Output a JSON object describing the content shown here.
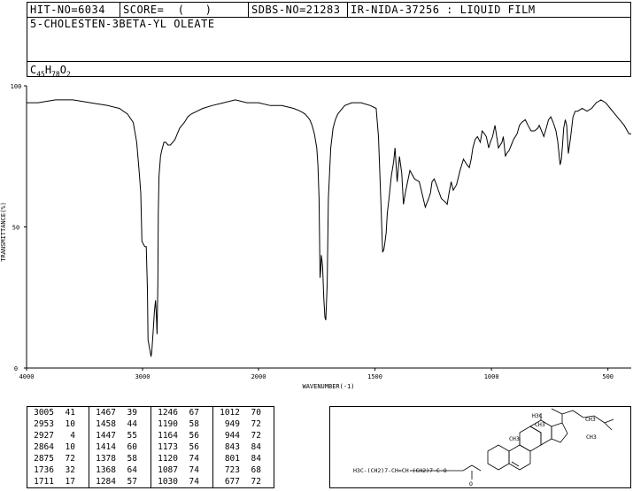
{
  "header": {
    "hit_no": "HIT-NO=6034",
    "score": "SCORE=  (   )",
    "sdbs_no": "SDBS-NO=21283",
    "ir_info": "IR-NIDA-37256 : LIQUID FILM",
    "compound_name": "5-CHOLESTEN-3BETA-YL OLEATE",
    "formula_parts": {
      "c": "C",
      "c_sub": "45",
      "h": "H",
      "h_sub": "78",
      "o": "O",
      "o_sub": "2"
    }
  },
  "chart_data": {
    "type": "line",
    "xlabel": "WAVENUMBER(-1)",
    "ylabel": "TRANSMITTANCE(%)",
    "xlim": [
      4000,
      400
    ],
    "ylim": [
      0,
      100
    ],
    "x_ticks": [
      4000,
      3000,
      2000,
      1500,
      1000,
      500
    ],
    "y_ticks": [
      0,
      50,
      100
    ],
    "series": [
      {
        "x": [
          4000,
          3900,
          3750,
          3600,
          3450,
          3300,
          3200,
          3130,
          3080,
          3050,
          3030,
          3015,
          3005,
          2995,
          2980,
          2968,
          2958,
          2953,
          2948,
          2940,
          2935,
          2927,
          2920,
          2910,
          2898,
          2888,
          2880,
          2875,
          2868,
          2864,
          2858,
          2850,
          2845,
          2835,
          2815,
          2800,
          2780,
          2760,
          2740,
          2720,
          2700,
          2680,
          2660,
          2640,
          2610,
          2580,
          2530,
          2480,
          2400,
          2300,
          2200,
          2100,
          2050,
          2000,
          1950,
          1900,
          1850,
          1820,
          1800,
          1790,
          1780,
          1770,
          1760,
          1750,
          1745,
          1740,
          1736,
          1733,
          1730,
          1725,
          1720,
          1715,
          1711,
          1705,
          1700,
          1690,
          1680,
          1670,
          1660,
          1650,
          1630,
          1600,
          1560,
          1520,
          1495,
          1485,
          1475,
          1467,
          1462,
          1458,
          1452,
          1447,
          1440,
          1430,
          1420,
          1414,
          1405,
          1395,
          1385,
          1378,
          1370,
          1360,
          1350,
          1330,
          1310,
          1284,
          1270,
          1262,
          1255,
          1246,
          1236,
          1228,
          1215,
          1200,
          1190,
          1182,
          1173,
          1164,
          1150,
          1135,
          1120,
          1105,
          1095,
          1087,
          1080,
          1070,
          1060,
          1048,
          1040,
          1030,
          1022,
          1012,
          1005,
          995,
          985,
          970,
          955,
          949,
          940,
          935,
          925,
          915,
          905,
          890,
          880,
          870,
          855,
          843,
          830,
          815,
          801,
          795,
          785,
          775,
          765,
          755,
          745,
          735,
          723,
          715,
          705,
          700,
          695,
          690,
          683,
          677,
          670,
          660,
          650,
          640,
          630,
          610,
          590,
          570,
          550,
          530,
          510,
          500,
          490,
          470,
          450,
          430,
          410,
          400
        ],
        "values": [
          94,
          94,
          95,
          95,
          94,
          93,
          92,
          90,
          87,
          80,
          70,
          62,
          45,
          44,
          43,
          43,
          28,
          10,
          9,
          7,
          6,
          4,
          6,
          12,
          20,
          24,
          18,
          12,
          30,
          55,
          68,
          72,
          75,
          77,
          80,
          80,
          79,
          79,
          80,
          81,
          83,
          85,
          86,
          87,
          89,
          90,
          91,
          92,
          93,
          94,
          95,
          94,
          94,
          94,
          93,
          93,
          92,
          91,
          90,
          89,
          88,
          86,
          83,
          78,
          72,
          60,
          32,
          35,
          40,
          36,
          25,
          18,
          17,
          30,
          60,
          78,
          85,
          88,
          90,
          91,
          93,
          94,
          94,
          93,
          92,
          82,
          60,
          41,
          42,
          44,
          48,
          55,
          60,
          68,
          73,
          78,
          66,
          75,
          69,
          58,
          62,
          66,
          70,
          67,
          66,
          57,
          60,
          62,
          66,
          67,
          65,
          63,
          60,
          59,
          58,
          62,
          66,
          63,
          65,
          70,
          74,
          72,
          71,
          74,
          78,
          81,
          82,
          80,
          84,
          83,
          82,
          78,
          80,
          82,
          86,
          78,
          80,
          82,
          75,
          76,
          77,
          79,
          81,
          83,
          86,
          87,
          88,
          86,
          84,
          84,
          85,
          86,
          84,
          82,
          85,
          88,
          89,
          87,
          84,
          80,
          72,
          74,
          79,
          85,
          88,
          86,
          76,
          82,
          89,
          91,
          91,
          92,
          91,
          92,
          94,
          95,
          94,
          93,
          92,
          90,
          88,
          86,
          83,
          83
        ]
      }
    ]
  },
  "peak_table": [
    [
      [
        "3005",
        "41"
      ],
      [
        "2953",
        "10"
      ],
      [
        "2927",
        "4"
      ],
      [
        "2864",
        "10"
      ],
      [
        "2875",
        "72"
      ],
      [
        "1736",
        "32"
      ],
      [
        "1711",
        "17"
      ]
    ],
    [
      [
        "1467",
        "39"
      ],
      [
        "1458",
        "44"
      ],
      [
        "1447",
        "55"
      ],
      [
        "1414",
        "60"
      ],
      [
        "1378",
        "58"
      ],
      [
        "1368",
        "64"
      ],
      [
        "1284",
        "57"
      ]
    ],
    [
      [
        "1246",
        "67"
      ],
      [
        "1190",
        "58"
      ],
      [
        "1164",
        "56"
      ],
      [
        "1173",
        "56"
      ],
      [
        "1120",
        "74"
      ],
      [
        "1087",
        "74"
      ],
      [
        "1030",
        "74"
      ]
    ],
    [
      [
        "1012",
        "70"
      ],
      [
        "949",
        "72"
      ],
      [
        "944",
        "72"
      ],
      [
        "843",
        "84"
      ],
      [
        "801",
        "84"
      ],
      [
        "723",
        "68"
      ],
      [
        "677",
        "72"
      ]
    ]
  ],
  "structure": {
    "labels": {
      "h3c_top": "H3C",
      "ch3_right1": "CH3",
      "ch3_right2": "CH3",
      "ch3_ring1": "CH3",
      "ch3_ring2": "CH3",
      "chain": "H3C-(CH2)7-CH=CH-(CH2)7-C-O",
      "o_bottom": "O"
    }
  }
}
